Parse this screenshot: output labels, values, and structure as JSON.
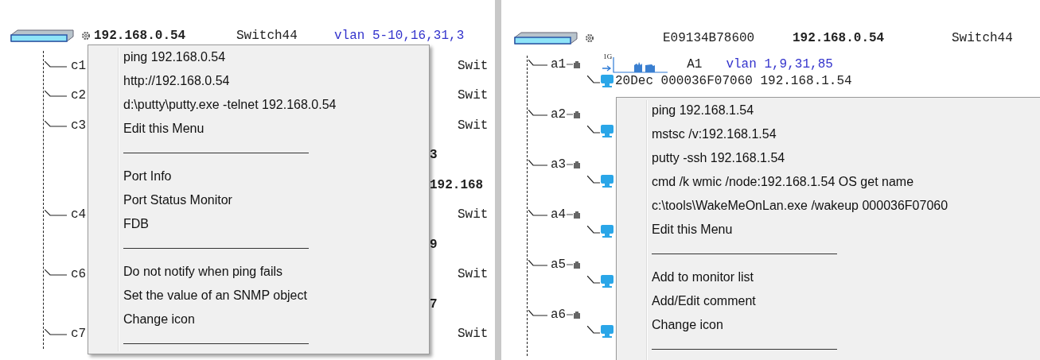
{
  "left_panel": {
    "root": {
      "address": "192.168.0.54",
      "name": "Switch44",
      "vlan": "vlan 5-10,16,31,3"
    },
    "rows": [
      {
        "kind": "port",
        "label": "c1",
        "column_2": "Swit"
      },
      {
        "kind": "port",
        "label": "c2",
        "column_2": "Swit"
      },
      {
        "kind": "port",
        "label": "c3",
        "column_2": "Swit"
      },
      {
        "kind": "detail",
        "text": "3"
      },
      {
        "kind": "detail",
        "text": "192.168"
      },
      {
        "kind": "port",
        "label": "c4",
        "column_2": "Swit"
      },
      {
        "kind": "detail",
        "text": "9"
      },
      {
        "kind": "port",
        "label": "c6",
        "column_2": "Swit"
      },
      {
        "kind": "detail",
        "text": "7"
      },
      {
        "kind": "port",
        "label": "c7",
        "column_2": "Swit"
      }
    ],
    "context_menu": {
      "items": [
        {
          "kind": "item",
          "label": "ping 192.168.0.54"
        },
        {
          "kind": "item",
          "label": "http://192.168.0.54"
        },
        {
          "kind": "item",
          "label": "d:\\putty\\putty.exe -telnet 192.168.0.54"
        },
        {
          "kind": "item",
          "label": "Edit this Menu"
        },
        {
          "kind": "separator"
        },
        {
          "kind": "item",
          "label": "Port Info"
        },
        {
          "kind": "item",
          "label": "Port Status Monitor"
        },
        {
          "kind": "item",
          "label": "FDB"
        },
        {
          "kind": "separator"
        },
        {
          "kind": "item",
          "label": "Do not notify when ping fails"
        },
        {
          "kind": "item",
          "label": "Set the value of an SNMP object"
        },
        {
          "kind": "item",
          "label": "Change icon"
        },
        {
          "kind": "separator"
        }
      ]
    }
  },
  "right_panel": {
    "root": {
      "mac": "E09134B78600",
      "address": "192.168.0.54",
      "name": "Switch44"
    },
    "ports": [
      {
        "label": "a1",
        "speed": "1G",
        "port_name": "A1",
        "vlan": "vlan 1,9,31,85",
        "children": [
          {
            "kind": "host",
            "text": "20Dec 000036F07060 192.168.1.54"
          }
        ]
      },
      {
        "label": "a2",
        "children": [
          {
            "kind": "host"
          }
        ]
      },
      {
        "label": "a3",
        "children": [
          {
            "kind": "host"
          }
        ]
      },
      {
        "label": "a4",
        "children": [
          {
            "kind": "host"
          }
        ]
      },
      {
        "label": "a5",
        "children": [
          {
            "kind": "host"
          }
        ]
      },
      {
        "label": "a6",
        "children": [
          {
            "kind": "host"
          }
        ]
      }
    ],
    "context_menu": {
      "items": [
        {
          "kind": "item",
          "label": "ping 192.168.1.54"
        },
        {
          "kind": "item",
          "label": "mstsc /v:192.168.1.54"
        },
        {
          "kind": "item",
          "label": "putty -ssh 192.168.1.54"
        },
        {
          "kind": "item",
          "label": "cmd /k wmic /node:192.168.1.54  OS get name"
        },
        {
          "kind": "item",
          "label": "c:\\tools\\WakeMeOnLan.exe /wakeup 000036F07060"
        },
        {
          "kind": "item",
          "label": "Edit this Menu"
        },
        {
          "kind": "separator"
        },
        {
          "kind": "item",
          "label": "Add to monitor list"
        },
        {
          "kind": "item",
          "label": "Add/Edit comment"
        },
        {
          "kind": "item",
          "label": "Change icon"
        },
        {
          "kind": "separator"
        }
      ]
    }
  }
}
